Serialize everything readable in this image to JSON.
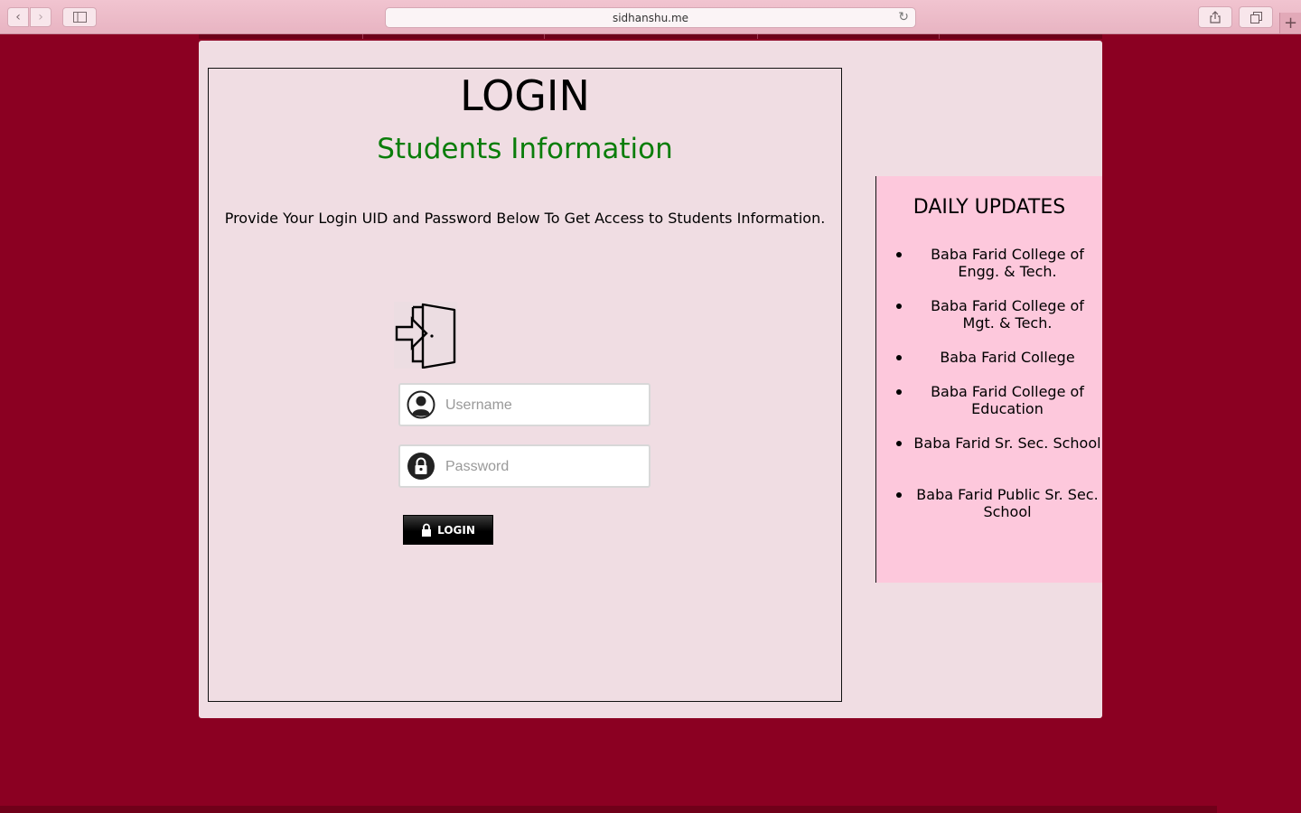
{
  "browser": {
    "url": "sidhanshu.me",
    "back_glyph": "‹",
    "forward_glyph": "›",
    "reload_glyph": "↻",
    "newtab_glyph": "+"
  },
  "login": {
    "title": "LOGIN",
    "subtitle": "Students Information",
    "instructions": "Provide Your Login UID and Password Below To Get Access to Students Information.",
    "username_placeholder": "Username",
    "password_placeholder": "Password",
    "button_label": "LOGIN"
  },
  "updates": {
    "title": "DAILY UPDATES",
    "items": [
      "Baba Farid College of Engg. & Tech.",
      "Baba Farid College of Mgt. & Tech.",
      "Baba Farid College",
      "Baba Farid College of Education",
      "Baba Farid Sr. Sec. School",
      "Baba Farid Public Sr. Sec. School"
    ]
  },
  "colors": {
    "background": "#8b0022",
    "page": "#f0dde3",
    "subtitle": "#0a7d0a",
    "updates_panel": "#fdc8dc"
  }
}
